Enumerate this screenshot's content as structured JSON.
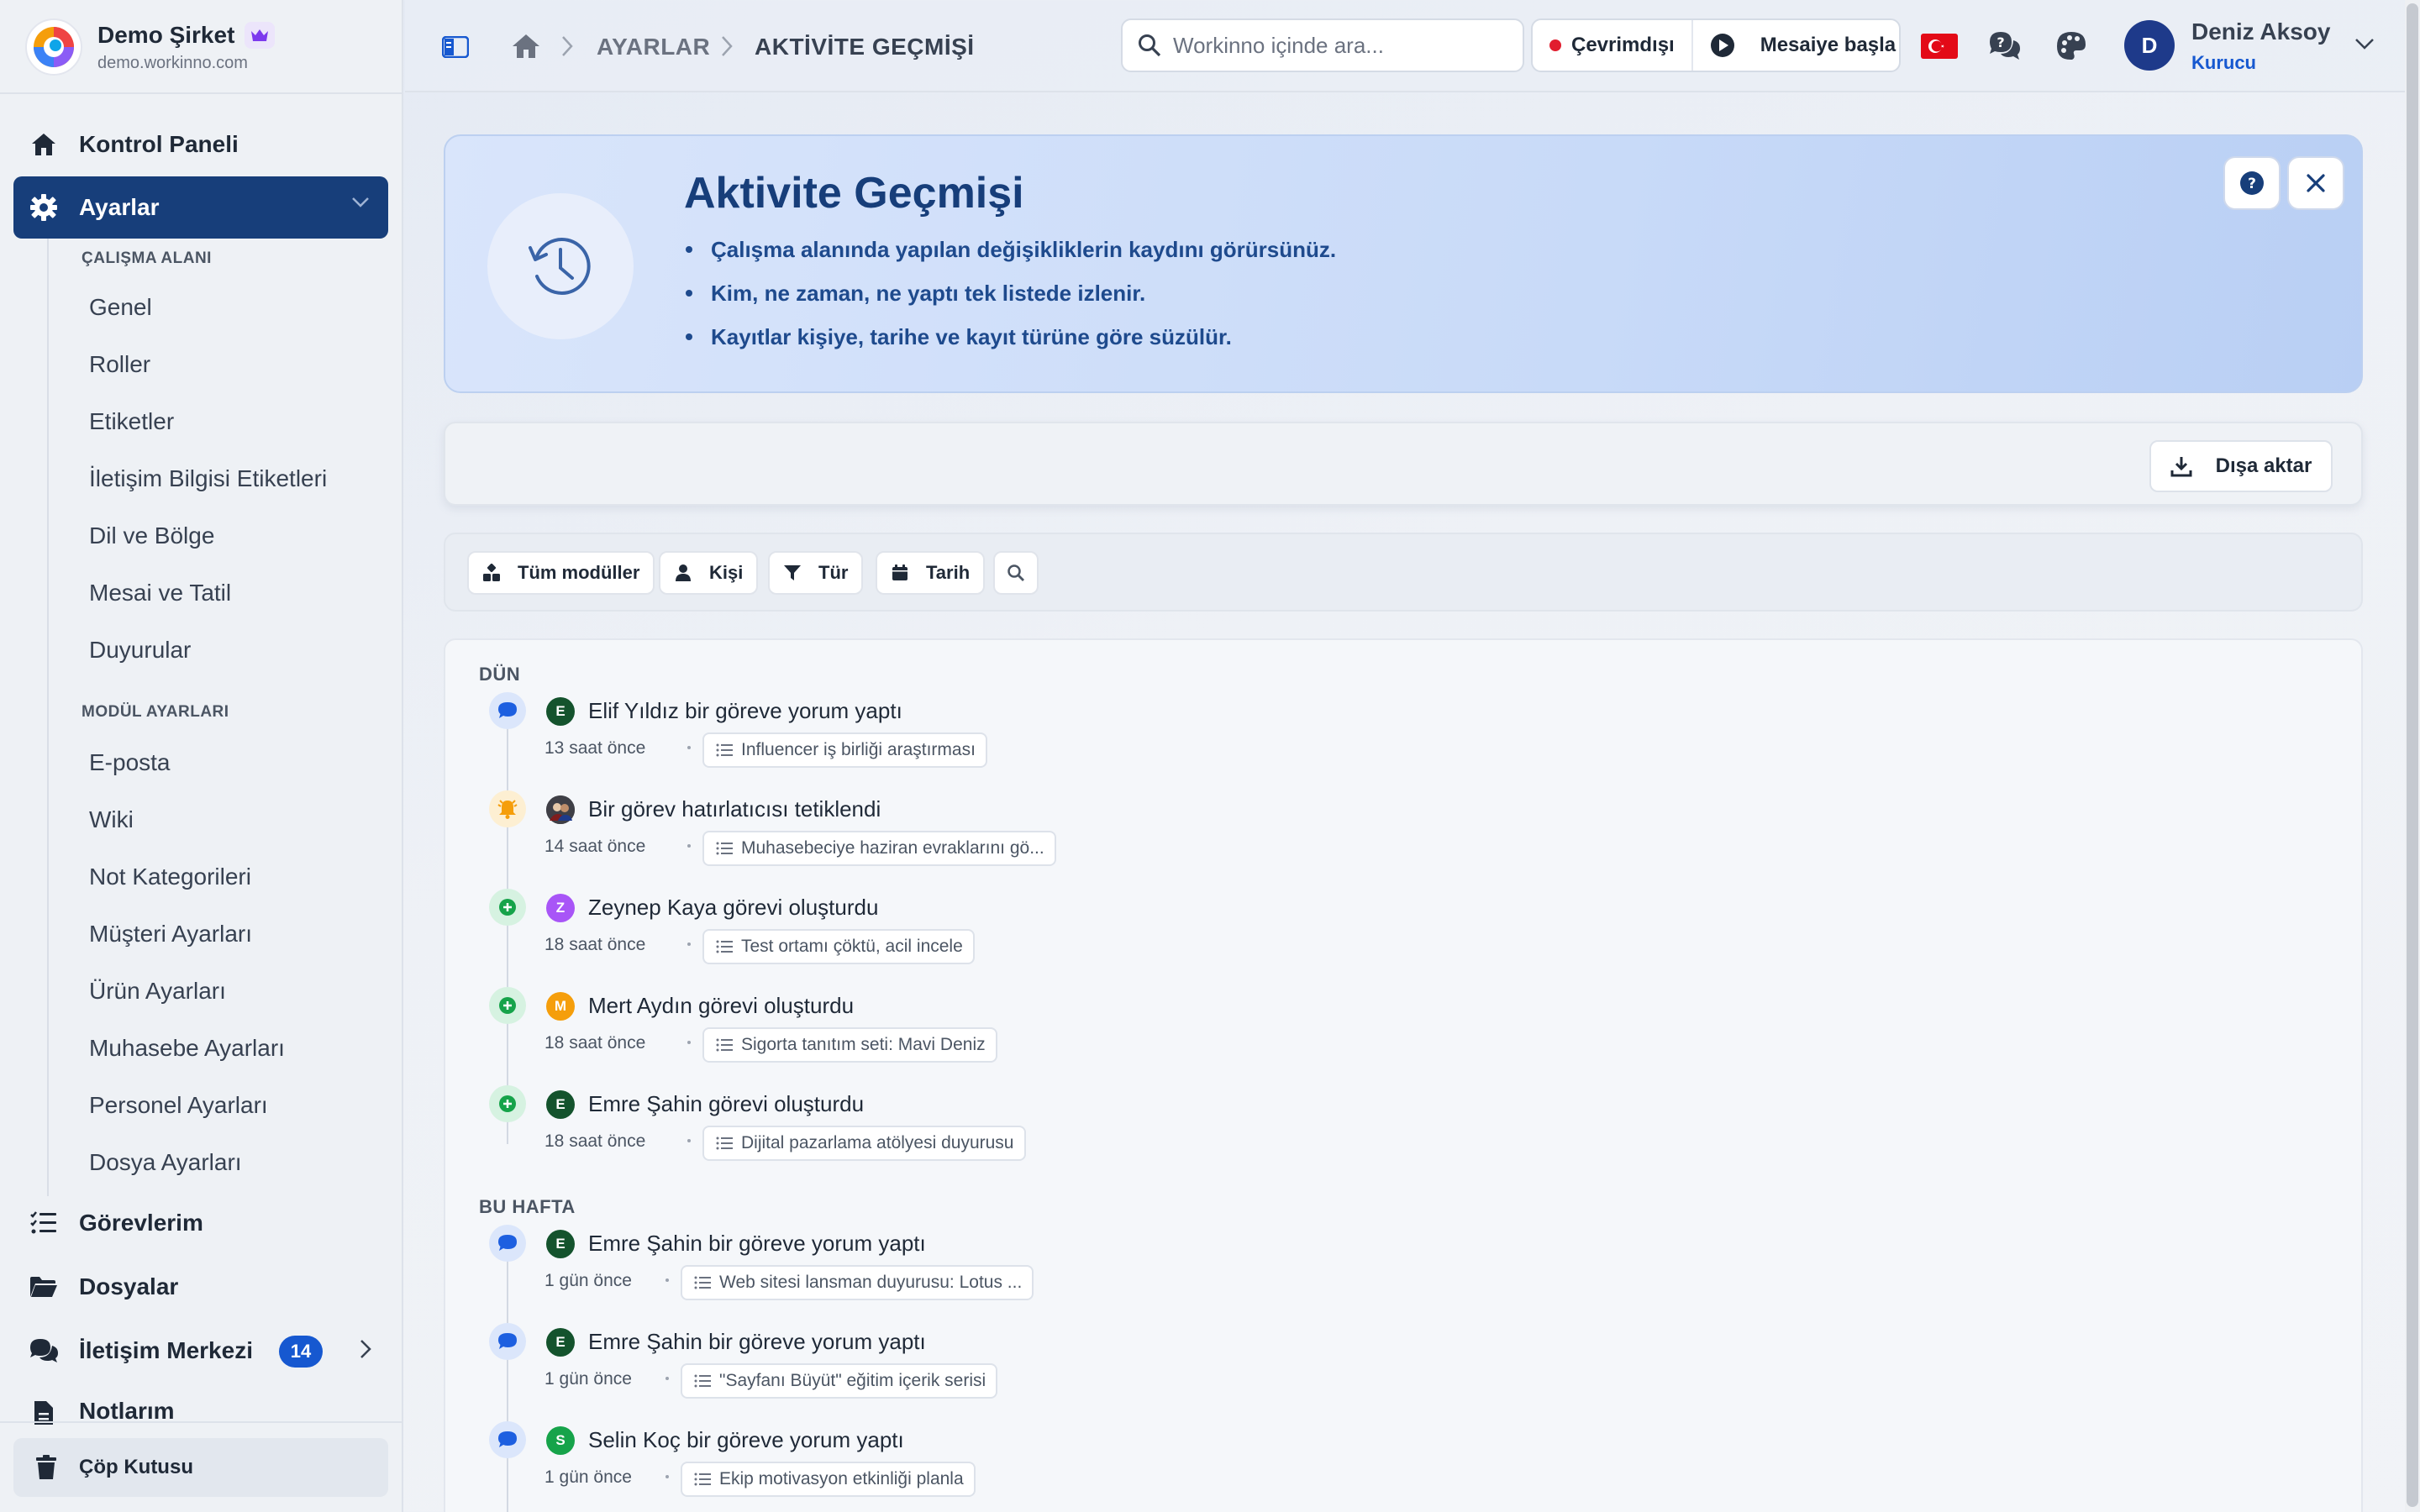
{
  "brand": {
    "name": "Demo Şirket",
    "domain": "demo.workinno.com"
  },
  "sidebar": {
    "dashboard": "Kontrol Paneli",
    "settings": "Ayarlar",
    "workspace_title": "ÇALIŞMA ALANI",
    "workspace_items": [
      "Genel",
      "Roller",
      "Etiketler",
      "İletişim Bilgisi Etiketleri",
      "Dil ve Bölge",
      "Mesai ve Tatil",
      "Duyurular"
    ],
    "module_title": "MODÜL AYARLARI",
    "module_items": [
      "E-posta",
      "Wiki",
      "Not Kategorileri",
      "Müşteri Ayarları",
      "Ürün Ayarları",
      "Muhasebe Ayarları",
      "Personel Ayarları",
      "Dosya Ayarları"
    ],
    "tasks": "Görevlerim",
    "files": "Dosyalar",
    "comm": "İletişim Merkezi",
    "comm_badge": "14",
    "notes": "Notlarım",
    "trash": "Çöp Kutusu"
  },
  "topbar": {
    "breadcrumb": [
      "AYARLAR",
      "AKTİVİTE GEÇMİŞİ"
    ],
    "search_placeholder": "Workinno içinde ara...",
    "status": "Çevrimdışı",
    "shift": "Mesaiye başla",
    "user_name": "Deniz Aksoy",
    "user_role": "Kurucu",
    "user_initial": "D"
  },
  "hero": {
    "title": "Aktivite Geçmişi",
    "bullets": [
      "Çalışma alanında yapılan değişikliklerin kaydını görürsünüz.",
      "Kim, ne zaman, ne yaptı tek listede izlenir.",
      "Kayıtlar kişiye, tarihe ve kayıt türüne göre süzülür."
    ]
  },
  "export_label": "Dışa aktar",
  "filters": {
    "modules": "Tüm modüller",
    "person": "Kişi",
    "type": "Tür",
    "date": "Tarih"
  },
  "colors": {
    "accent": "#173e7a",
    "badge": "#1658d0",
    "comment": "#1d5fe0",
    "create": "#16a34a",
    "reminder": "#f59e0b"
  },
  "activity": {
    "groups": [
      {
        "label": "DÜN",
        "items": [
          {
            "type": "comment",
            "initial": "E",
            "avatar_color": "#14532d",
            "text": "Elif Yıldız bir göreve yorum yaptı",
            "time": "13 saat önce",
            "link": "Influencer iş birliği araştırması"
          },
          {
            "type": "reminder",
            "initial": "",
            "avatar_color": "#3f3f46",
            "text": "Bir görev hatırlatıcısı tetiklendi",
            "time": "14 saat önce",
            "link": "Muhasebeciye haziran evraklarını gö..."
          },
          {
            "type": "create",
            "initial": "Z",
            "avatar_color": "#a855f7",
            "text": "Zeynep Kaya görevi oluşturdu",
            "time": "18 saat önce",
            "link": "Test ortamı çöktü, acil incele"
          },
          {
            "type": "create",
            "initial": "M",
            "avatar_color": "#f59e0b",
            "text": "Mert Aydın görevi oluşturdu",
            "time": "18 saat önce",
            "link": "Sigorta tanıtım seti: Mavi Deniz"
          },
          {
            "type": "create",
            "initial": "E",
            "avatar_color": "#14532d",
            "text": "Emre Şahin görevi oluşturdu",
            "time": "18 saat önce",
            "link": "Dijital pazarlama atölyesi duyurusu"
          }
        ]
      },
      {
        "label": "BU HAFTA",
        "items": [
          {
            "type": "comment",
            "initial": "E",
            "avatar_color": "#14532d",
            "text": "Emre Şahin bir göreve yorum yaptı",
            "time": "1 gün önce",
            "link": "Web sitesi lansman duyurusu: Lotus ..."
          },
          {
            "type": "comment",
            "initial": "E",
            "avatar_color": "#14532d",
            "text": "Emre Şahin bir göreve yorum yaptı",
            "time": "1 gün önce",
            "link": "\"Sayfanı Büyüt\" eğitim içerik serisi"
          },
          {
            "type": "comment",
            "initial": "S",
            "avatar_color": "#16a34a",
            "text": "Selin Koç bir göreve yorum yaptı",
            "time": "1 gün önce",
            "link": "Ekip motivasyon etkinliği planla"
          }
        ]
      }
    ]
  }
}
